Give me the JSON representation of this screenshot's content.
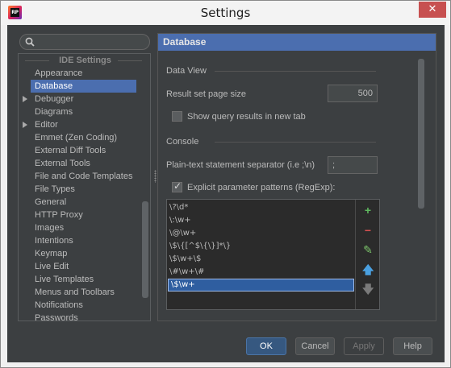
{
  "window": {
    "title": "Settings",
    "app_icon_label": "RP",
    "close_glyph": "✕"
  },
  "sidebar": {
    "header": "IDE Settings",
    "items": [
      {
        "label": "Appearance",
        "expandable": false,
        "selected": false
      },
      {
        "label": "Database",
        "expandable": false,
        "selected": true
      },
      {
        "label": "Debugger",
        "expandable": true,
        "selected": false
      },
      {
        "label": "Diagrams",
        "expandable": false,
        "selected": false
      },
      {
        "label": "Editor",
        "expandable": true,
        "selected": false
      },
      {
        "label": "Emmet (Zen Coding)",
        "expandable": false,
        "selected": false
      },
      {
        "label": "External Diff Tools",
        "expandable": false,
        "selected": false
      },
      {
        "label": "External Tools",
        "expandable": false,
        "selected": false
      },
      {
        "label": "File and Code Templates",
        "expandable": false,
        "selected": false
      },
      {
        "label": "File Types",
        "expandable": false,
        "selected": false
      },
      {
        "label": "General",
        "expandable": false,
        "selected": false
      },
      {
        "label": "HTTP Proxy",
        "expandable": false,
        "selected": false
      },
      {
        "label": "Images",
        "expandable": false,
        "selected": false
      },
      {
        "label": "Intentions",
        "expandable": false,
        "selected": false
      },
      {
        "label": "Keymap",
        "expandable": false,
        "selected": false
      },
      {
        "label": "Live Edit",
        "expandable": false,
        "selected": false
      },
      {
        "label": "Live Templates",
        "expandable": false,
        "selected": false
      },
      {
        "label": "Menus and Toolbars",
        "expandable": false,
        "selected": false
      },
      {
        "label": "Notifications",
        "expandable": false,
        "selected": false
      },
      {
        "label": "Passwords",
        "expandable": false,
        "selected": false
      }
    ]
  },
  "panel": {
    "title": "Database",
    "data_view": {
      "section_label": "Data View",
      "page_size_label": "Result set page size",
      "page_size_value": "500",
      "show_query_label": "Show query results in new tab",
      "show_query_checked": false
    },
    "console": {
      "section_label": "Console",
      "separator_label": "Plain-text statement separator (i.e ;\\n)",
      "separator_value": ";",
      "explicit_patterns_label": "Explicit parameter patterns (RegExp):",
      "explicit_patterns_checked": true,
      "patterns": [
        "\\?\\d*",
        "\\:\\w+",
        "\\@\\w+",
        "\\$\\{[^$\\{\\}]*\\}",
        "\\$\\w+\\$",
        "\\#\\w+\\#",
        "\\$\\w+"
      ],
      "selected_pattern_index": 6
    },
    "tools": [
      {
        "icon": "add-icon",
        "glyph": "+",
        "color": "#5fb85f"
      },
      {
        "icon": "remove-icon",
        "glyph": "−",
        "color": "#d65151"
      },
      {
        "icon": "edit-icon",
        "glyph": "✎",
        "color": "#7cc46b"
      },
      {
        "icon": "move-up-icon",
        "glyph": "🡅",
        "color": "#4aa0e0"
      },
      {
        "icon": "move-down-icon",
        "glyph": "🡇",
        "color": "#7a7a7a"
      }
    ]
  },
  "buttons": {
    "ok": "OK",
    "cancel": "Cancel",
    "apply": "Apply",
    "help": "Help"
  },
  "colors": {
    "accent": "#4b6eaf",
    "background": "#3c3f41"
  }
}
